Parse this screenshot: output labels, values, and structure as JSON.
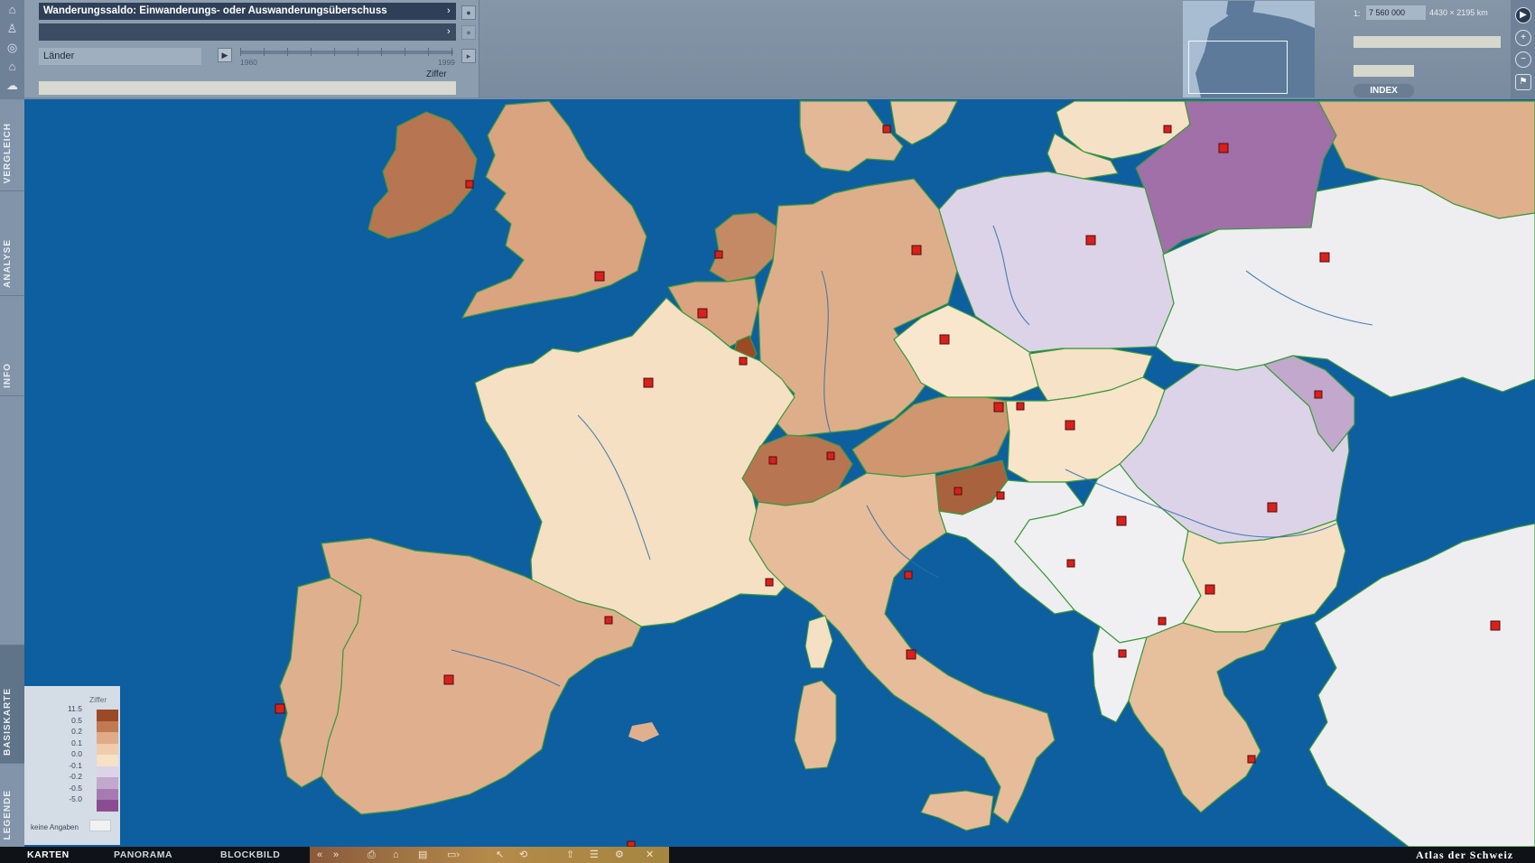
{
  "map_title": "Wanderungssaldo: Einwanderungs- oder Auswanderungsüberschuss",
  "level_label": "Länder",
  "timeline": {
    "start_year": "1960",
    "end_year": "1999"
  },
  "unit_label": "Ziffer",
  "scale": {
    "prefix": "1:",
    "value": "7 560 000",
    "extent": "4430 × 2195 km"
  },
  "index_label": "INDEX",
  "side_tabs": {
    "vergleich": "VERGLEICH",
    "analyse": "ANALYSE",
    "info": "INFO",
    "basiskarte": "BASISKARTE",
    "legende": "LEGENDE"
  },
  "legend": {
    "title": "Ziffer",
    "classes": [
      {
        "value": "11.5",
        "color": "#9b4a26"
      },
      {
        "value": "0.5",
        "color": "#c07a52"
      },
      {
        "value": "0.2",
        "color": "#e0ac88"
      },
      {
        "value": "0.1",
        "color": "#f1ccaa"
      },
      {
        "value": "0.0",
        "color": "#f6e2c6"
      },
      {
        "value": "-0.1",
        "color": "#dcd3e8"
      },
      {
        "value": "-0.2",
        "color": "#c2a8cd"
      },
      {
        "value": "-0.5",
        "color": "#a77bb1"
      },
      {
        "value": "-5.0",
        "color": "#8b4d92"
      }
    ],
    "no_data_label": "keine Angaben",
    "no_data_color": "#f1f1f1"
  },
  "bottom_tabs": {
    "karten": "KARTEN",
    "panorama": "PANORAMA",
    "blockbild": "BLOCKBILD"
  },
  "brand": "Atlas der Schweiz",
  "colors": {
    "sea": "#0e5f9f",
    "border": "#3a9a3a",
    "capital": "#d9201c"
  }
}
